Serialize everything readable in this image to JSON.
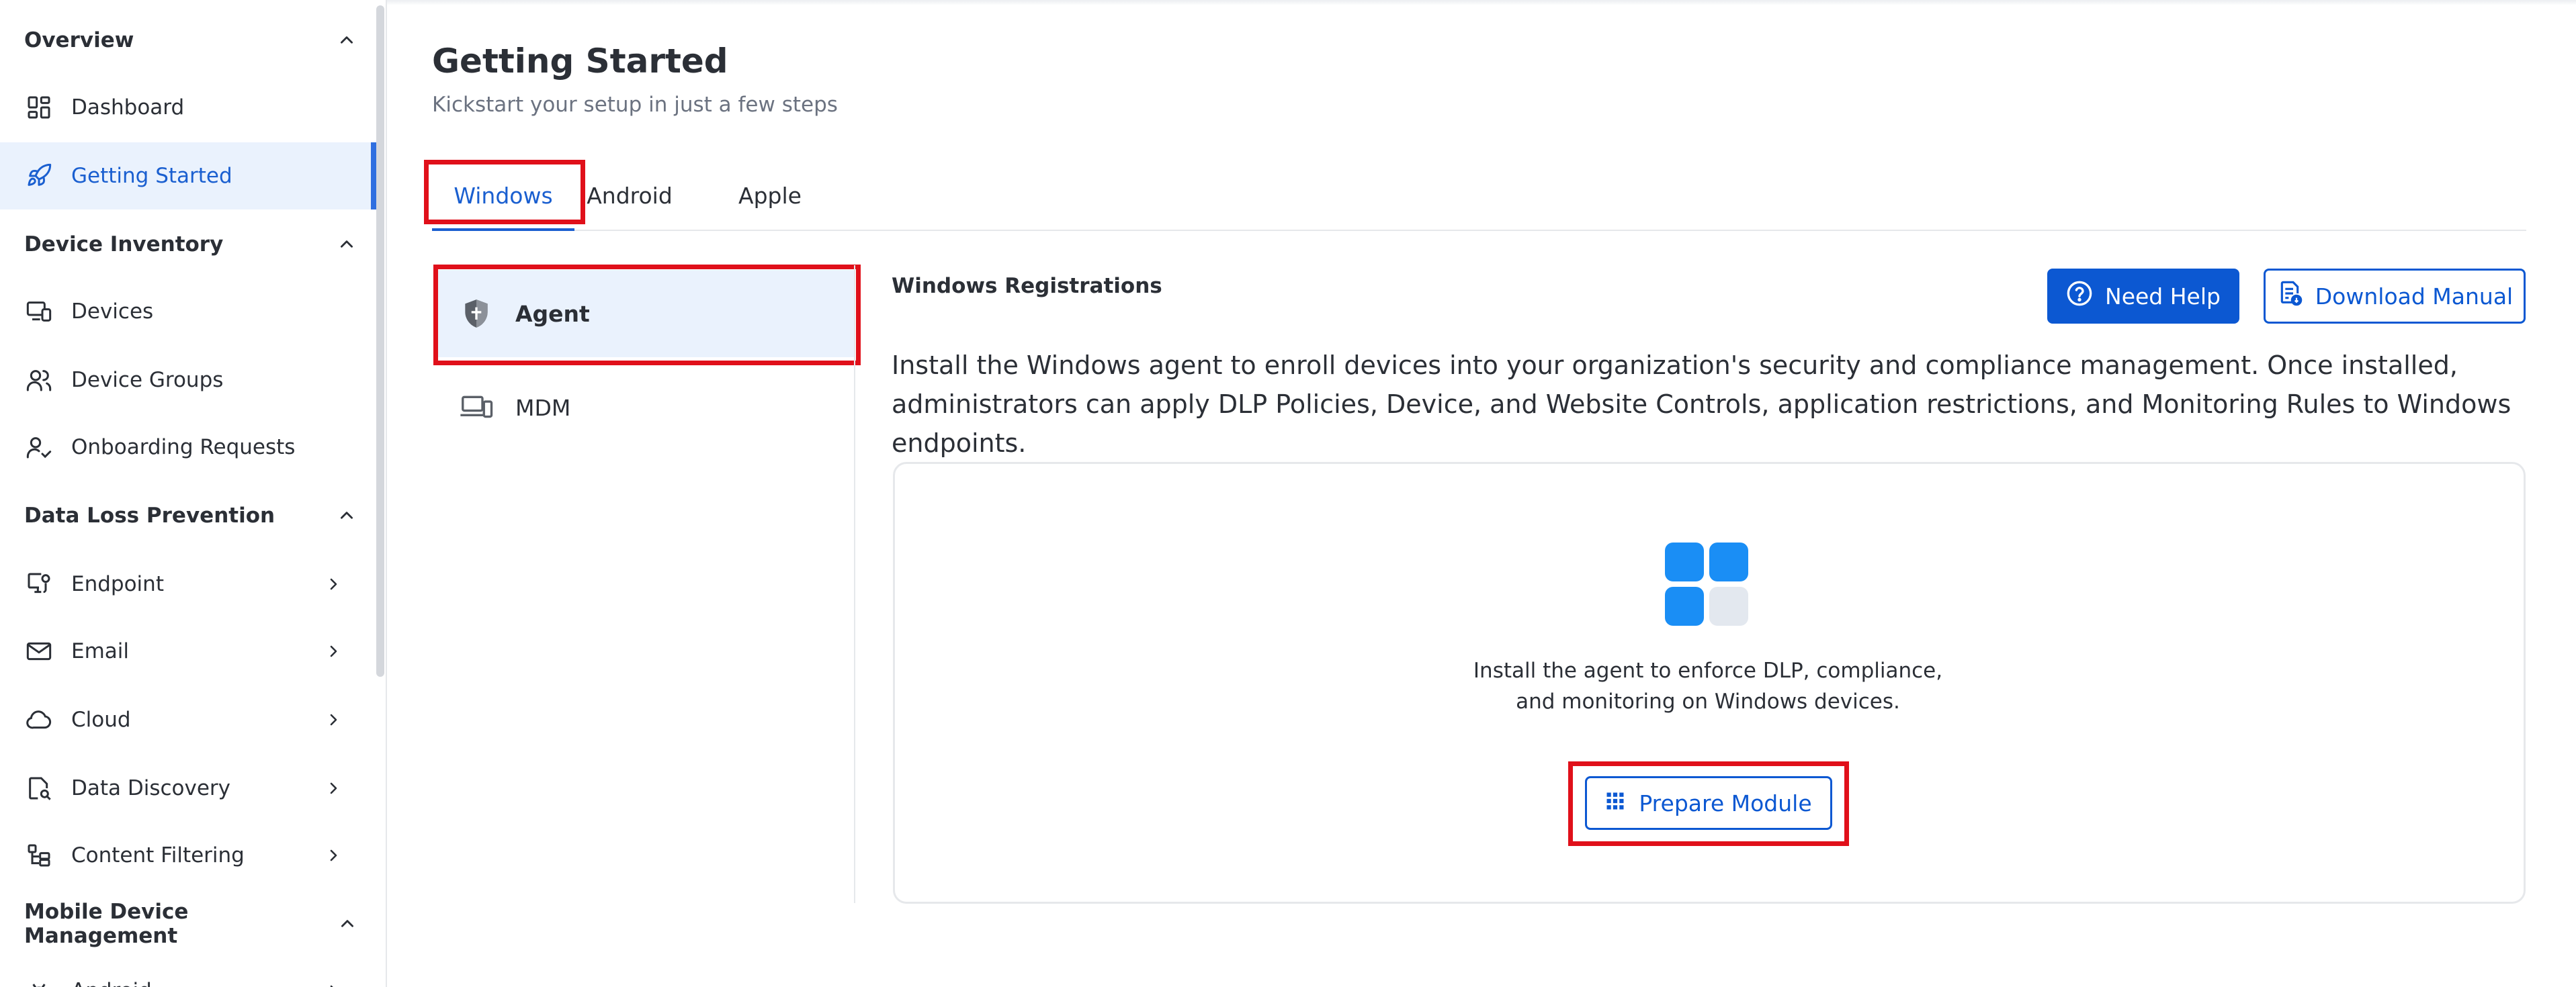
{
  "sidebar": {
    "sections": {
      "overview": "Overview",
      "device_inventory": "Device Inventory",
      "dlp": "Data Loss Prevention",
      "mdm": "Mobile Device Management"
    },
    "items": {
      "dashboard": "Dashboard",
      "getting_started": "Getting Started",
      "devices": "Devices",
      "device_groups": "Device Groups",
      "onboarding_requests": "Onboarding Requests",
      "endpoint": "Endpoint",
      "email": "Email",
      "cloud": "Cloud",
      "data_discovery": "Data Discovery",
      "content_filtering": "Content Filtering",
      "android": "Android"
    }
  },
  "header": {
    "title": "Getting Started",
    "subtitle": "Kickstart your setup in just a few steps"
  },
  "tabs": {
    "windows": "Windows",
    "android": "Android",
    "apple": "Apple"
  },
  "subnav": {
    "agent": "Agent",
    "mdm": "MDM"
  },
  "main": {
    "title": "Windows Registrations",
    "need_help": "Need Help",
    "download_manual": "Download Manual",
    "description": "Install the Windows agent to enroll devices into your organization's security and compliance management. Once installed, administrators can apply DLP Policies, Device, and Website Controls, application restrictions, and Monitoring Rules to Windows endpoints.",
    "card_line1": "Install the agent to enforce DLP, compliance,",
    "card_line2": "and monitoring on Windows devices.",
    "prepare_module": "Prepare Module"
  },
  "colors": {
    "accent": "#0c58d2",
    "highlight": "#e0101a",
    "active_bg": "#eaf2fd",
    "tile_blue": "#1a8ef5",
    "tile_light": "#e3e8ef"
  }
}
